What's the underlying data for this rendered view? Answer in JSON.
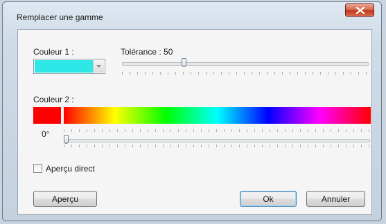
{
  "window": {
    "title": "Remplacer une gamme"
  },
  "color1": {
    "label": "Couleur 1 :",
    "value": "#2ee8e8"
  },
  "tolerance": {
    "label": "Tolérance : 50",
    "value": 50,
    "min": 0,
    "max": 100
  },
  "color2": {
    "label": "Couleur 2 :",
    "swatch": "#ff0000"
  },
  "hue": {
    "label": "0°",
    "value": 0
  },
  "preview_direct": {
    "label": "Aperçu direct",
    "checked": false
  },
  "buttons": {
    "apercu": "Aperçu",
    "ok": "Ok",
    "annuler": "Annuler"
  },
  "icons": {
    "close": "close-icon",
    "dropdown": "chevron-down-icon"
  }
}
